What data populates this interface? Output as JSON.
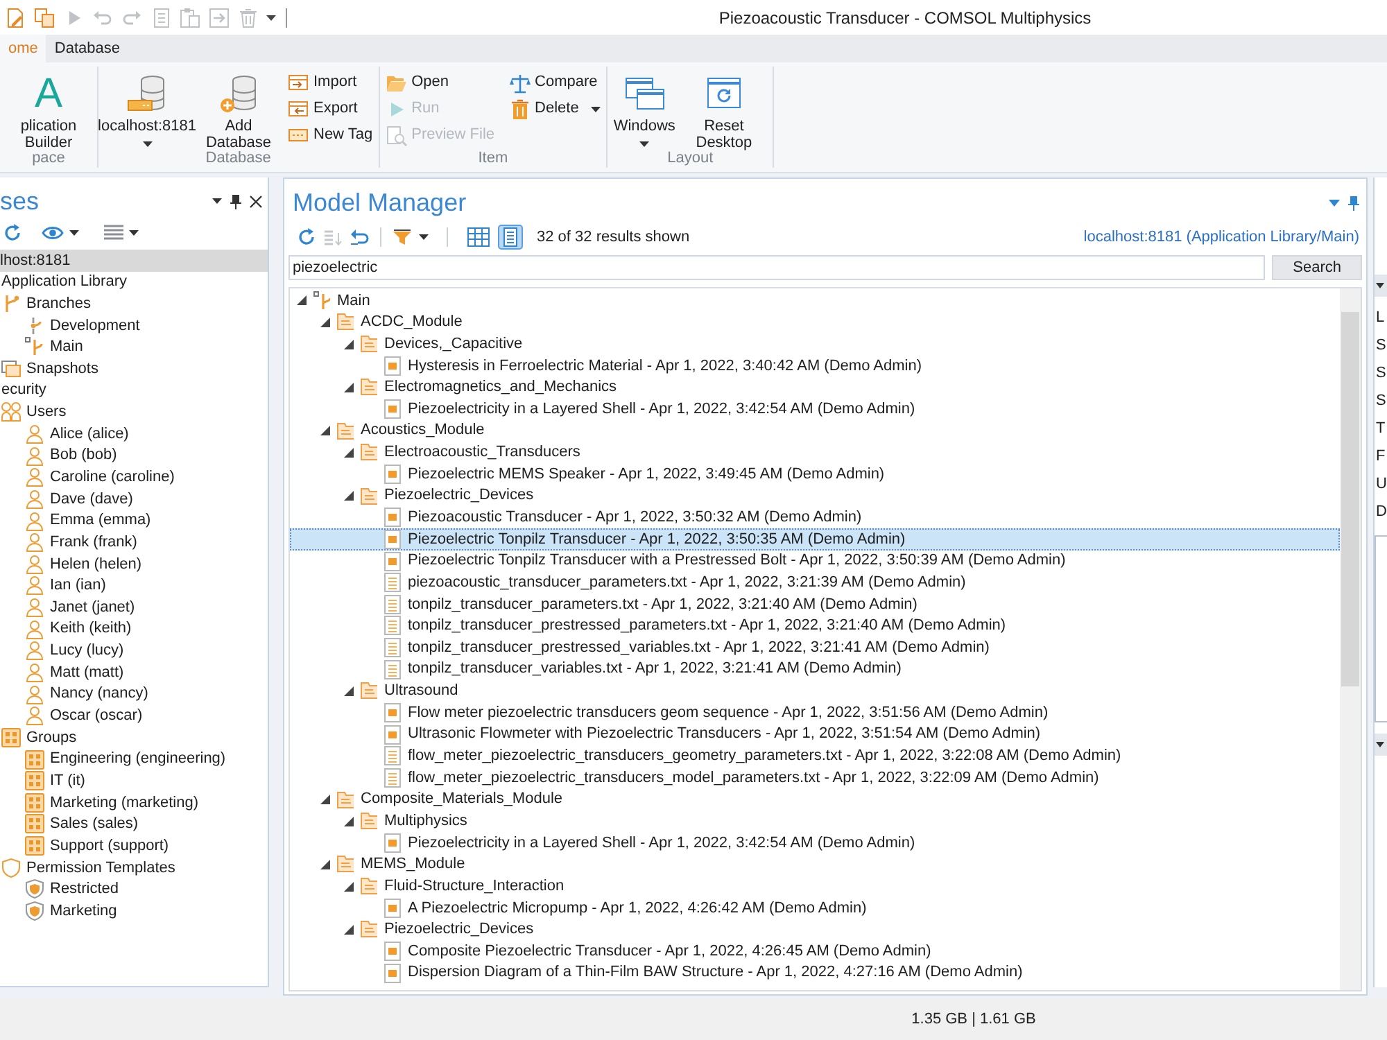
{
  "window": {
    "title": "Piezoacoustic Transducer - COMSOL Multiphysics"
  },
  "quick_access_toolbar": [
    {
      "disabled": false
    },
    {
      "disabled": false
    },
    {
      "disabled": true
    },
    {
      "disabled": true
    },
    {
      "disabled": true
    },
    {
      "disabled": true
    },
    {
      "disabled": true
    },
    {
      "disabled": true
    },
    {
      "disabled": true
    }
  ],
  "ribbon": {
    "tabs": [
      {
        "label": "ome",
        "selected": true
      },
      {
        "label": "Database",
        "selected": false
      }
    ],
    "groups": [
      {
        "label": "pace",
        "items": [
          {
            "kind": "large",
            "glyph": "A",
            "label": "plication Builder",
            "dropdown": false,
            "disabled": false
          }
        ]
      },
      {
        "label": "Database",
        "items": [
          {
            "kind": "large",
            "label": "localhost:8181",
            "dropdown": true,
            "disabled": false
          },
          {
            "kind": "large",
            "label": "Add Database",
            "dropdown": false,
            "disabled": false
          },
          {
            "kind": "small",
            "label": "Import",
            "dropdown": false,
            "disabled": false
          },
          {
            "kind": "small",
            "label": "Export",
            "dropdown": false,
            "disabled": false
          },
          {
            "kind": "small",
            "label": "New Tag",
            "dropdown": false,
            "disabled": false
          }
        ]
      },
      {
        "label": "Item",
        "items": [
          {
            "kind": "small",
            "label": "Open",
            "dropdown": false,
            "disabled": false
          },
          {
            "kind": "small",
            "label": "Run",
            "dropdown": false,
            "disabled": true
          },
          {
            "kind": "small",
            "label": "Preview File",
            "dropdown": false,
            "disabled": true
          },
          {
            "kind": "small",
            "label": "Compare",
            "dropdown": false,
            "disabled": false
          },
          {
            "kind": "small",
            "label": "Delete",
            "dropdown": true,
            "disabled": false
          }
        ]
      },
      {
        "label": "Layout",
        "items": [
          {
            "kind": "large",
            "label": "Windows",
            "dropdown": true,
            "disabled": false
          },
          {
            "kind": "large",
            "label": "Reset Desktop",
            "dropdown": false,
            "disabled": false
          }
        ]
      }
    ]
  },
  "databases_panel": {
    "title": "ses",
    "tree": [
      {
        "label": "lhost:8181",
        "selected": true,
        "children": [
          {
            "label": "Application Library",
            "selected": false,
            "children": [
              {
                "label": "Branches",
                "kind": "branches",
                "selected": false,
                "children": [
                  {
                    "label": "Development",
                    "kind": "branch",
                    "selected": false
                  },
                  {
                    "label": "Main",
                    "kind": "default-branch",
                    "selected": false
                  }
                ]
              },
              {
                "label": "Snapshots",
                "kind": "snapshots",
                "selected": false
              }
            ]
          },
          {
            "label": "ecurity",
            "selected": false,
            "children": [
              {
                "label": "Users",
                "kind": "users",
                "selected": false,
                "children": [
                  {
                    "label": "Alice (alice)",
                    "kind": "user",
                    "selected": false
                  },
                  {
                    "label": "Bob (bob)",
                    "kind": "user",
                    "selected": false
                  },
                  {
                    "label": "Caroline (caroline)",
                    "kind": "user",
                    "selected": false
                  },
                  {
                    "label": "Dave (dave)",
                    "kind": "user",
                    "selected": false
                  },
                  {
                    "label": "Emma (emma)",
                    "kind": "user",
                    "selected": false
                  },
                  {
                    "label": "Frank (frank)",
                    "kind": "user",
                    "selected": false
                  },
                  {
                    "label": "Helen (helen)",
                    "kind": "user",
                    "selected": false
                  },
                  {
                    "label": "Ian (ian)",
                    "kind": "user",
                    "selected": false
                  },
                  {
                    "label": "Janet (janet)",
                    "kind": "user",
                    "selected": false
                  },
                  {
                    "label": "Keith (keith)",
                    "kind": "user",
                    "selected": false
                  },
                  {
                    "label": "Lucy (lucy)",
                    "kind": "user",
                    "selected": false
                  },
                  {
                    "label": "Matt (matt)",
                    "kind": "user",
                    "selected": false
                  },
                  {
                    "label": "Nancy (nancy)",
                    "kind": "user",
                    "selected": false
                  },
                  {
                    "label": "Oscar (oscar)",
                    "kind": "user",
                    "selected": false
                  }
                ]
              },
              {
                "label": "Groups",
                "kind": "groups",
                "selected": false,
                "children": [
                  {
                    "label": "Engineering (engineering)",
                    "kind": "group",
                    "selected": false
                  },
                  {
                    "label": "IT (it)",
                    "kind": "group",
                    "selected": false
                  },
                  {
                    "label": "Marketing (marketing)",
                    "kind": "group",
                    "selected": false
                  },
                  {
                    "label": "Sales (sales)",
                    "kind": "group",
                    "selected": false
                  },
                  {
                    "label": "Support (support)",
                    "kind": "group",
                    "selected": false
                  }
                ]
              },
              {
                "label": "Permission Templates",
                "kind": "templates",
                "selected": false,
                "children": [
                  {
                    "label": "Restricted",
                    "kind": "template",
                    "selected": false
                  },
                  {
                    "label": "Marketing",
                    "kind": "template",
                    "selected": false
                  }
                ]
              }
            ]
          }
        ]
      }
    ]
  },
  "model_manager": {
    "title": "Model Manager",
    "tools": [
      {
        "disabled": false
      },
      {
        "disabled": true
      },
      {
        "disabled": false
      },
      {
        "disabled": false
      }
    ],
    "view_modes": [
      {
        "selected": false
      },
      {
        "selected": true
      }
    ],
    "results": "32 of 32 results shown",
    "location_link": "localhost:8181 (Application Library/Main)",
    "search": {
      "value": "piezoelectric",
      "button": "Search"
    },
    "tree": [
      {
        "label": "Main",
        "kind": "default-branch",
        "expanded": true,
        "selected": false,
        "children": [
          {
            "label": "ACDC_Module",
            "kind": "folder",
            "expanded": true,
            "selected": false,
            "children": [
              {
                "label": "Devices,_Capacitive",
                "kind": "folder",
                "expanded": true,
                "selected": false,
                "children": [
                  {
                    "label": "Hysteresis in Ferroelectric Material - Apr 1, 2022, 3:40:42 AM (Demo Admin)",
                    "kind": "model",
                    "selected": false
                  }
                ]
              },
              {
                "label": "Electromagnetics_and_Mechanics",
                "kind": "folder",
                "expanded": true,
                "selected": false,
                "children": [
                  {
                    "label": "Piezoelectricity in a Layered Shell - Apr 1, 2022, 3:42:54 AM (Demo Admin)",
                    "kind": "model",
                    "selected": false
                  }
                ]
              }
            ]
          },
          {
            "label": "Acoustics_Module",
            "kind": "folder",
            "expanded": true,
            "selected": false,
            "children": [
              {
                "label": "Electroacoustic_Transducers",
                "kind": "folder",
                "expanded": true,
                "selected": false,
                "children": [
                  {
                    "label": "Piezoelectric MEMS Speaker - Apr 1, 2022, 3:49:45 AM (Demo Admin)",
                    "kind": "model",
                    "selected": false
                  }
                ]
              },
              {
                "label": "Piezoelectric_Devices",
                "kind": "folder",
                "expanded": true,
                "selected": false,
                "children": [
                  {
                    "label": "Piezoacoustic Transducer - Apr 1, 2022, 3:50:32 AM (Demo Admin)",
                    "kind": "model",
                    "selected": false
                  },
                  {
                    "label": "Piezoelectric Tonpilz Transducer - Apr 1, 2022, 3:50:35 AM (Demo Admin)",
                    "kind": "model",
                    "selected": true
                  },
                  {
                    "label": "Piezoelectric Tonpilz Transducer with a Prestressed Bolt - Apr 1, 2022, 3:50:39 AM (Demo Admin)",
                    "kind": "model",
                    "selected": false
                  },
                  {
                    "label": "piezoacoustic_transducer_parameters.txt - Apr 1, 2022, 3:21:39 AM (Demo Admin)",
                    "kind": "file",
                    "selected": false
                  },
                  {
                    "label": "tonpilz_transducer_parameters.txt - Apr 1, 2022, 3:21:40 AM (Demo Admin)",
                    "kind": "file",
                    "selected": false
                  },
                  {
                    "label": "tonpilz_transducer_prestressed_parameters.txt - Apr 1, 2022, 3:21:40 AM (Demo Admin)",
                    "kind": "file",
                    "selected": false
                  },
                  {
                    "label": "tonpilz_transducer_prestressed_variables.txt - Apr 1, 2022, 3:21:41 AM (Demo Admin)",
                    "kind": "file",
                    "selected": false
                  },
                  {
                    "label": "tonpilz_transducer_variables.txt - Apr 1, 2022, 3:21:41 AM (Demo Admin)",
                    "kind": "file",
                    "selected": false
                  }
                ]
              },
              {
                "label": "Ultrasound",
                "kind": "folder",
                "expanded": true,
                "selected": false,
                "children": [
                  {
                    "label": "Flow meter piezoelectric transducers geom sequence - Apr 1, 2022, 3:51:56 AM (Demo Admin)",
                    "kind": "model",
                    "selected": false
                  },
                  {
                    "label": "Ultrasonic Flowmeter with Piezoelectric Transducers - Apr 1, 2022, 3:51:54 AM (Demo Admin)",
                    "kind": "model",
                    "selected": false
                  },
                  {
                    "label": "flow_meter_piezoelectric_transducers_geometry_parameters.txt - Apr 1, 2022, 3:22:08 AM (Demo Admin)",
                    "kind": "file",
                    "selected": false
                  },
                  {
                    "label": "flow_meter_piezoelectric_transducers_model_parameters.txt - Apr 1, 2022, 3:22:09 AM (Demo Admin)",
                    "kind": "file",
                    "selected": false
                  }
                ]
              }
            ]
          },
          {
            "label": "Composite_Materials_Module",
            "kind": "folder",
            "expanded": true,
            "selected": false,
            "children": [
              {
                "label": "Multiphysics",
                "kind": "folder",
                "expanded": true,
                "selected": false,
                "children": [
                  {
                    "label": "Piezoelectricity in a Layered Shell - Apr 1, 2022, 3:42:54 AM (Demo Admin)",
                    "kind": "model",
                    "selected": false
                  }
                ]
              }
            ]
          },
          {
            "label": "MEMS_Module",
            "kind": "folder",
            "expanded": true,
            "selected": false,
            "children": [
              {
                "label": "Fluid-Structure_Interaction",
                "kind": "folder",
                "expanded": true,
                "selected": false,
                "children": [
                  {
                    "label": "A Piezoelectric Micropump - Apr 1, 2022, 4:26:42 AM (Demo Admin)",
                    "kind": "model",
                    "selected": false
                  }
                ]
              },
              {
                "label": "Piezoelectric_Devices",
                "kind": "folder",
                "expanded": true,
                "selected": false,
                "children": [
                  {
                    "label": "Composite Piezoelectric Transducer - Apr 1, 2022, 4:26:45 AM (Demo Admin)",
                    "kind": "model",
                    "selected": false
                  },
                  {
                    "label": "Dispersion Diagram of a Thin-Film BAW Structure - Apr 1, 2022, 4:27:16 AM (Demo Admin)",
                    "kind": "model",
                    "selected": false
                  }
                ]
              }
            ]
          }
        ]
      }
    ]
  },
  "right_panel": {
    "labels": [
      "L",
      "S",
      "S",
      "S",
      "T",
      "F",
      "U",
      "D"
    ]
  },
  "status_bar": {
    "memory": "1.35 GB | 1.61 GB"
  }
}
